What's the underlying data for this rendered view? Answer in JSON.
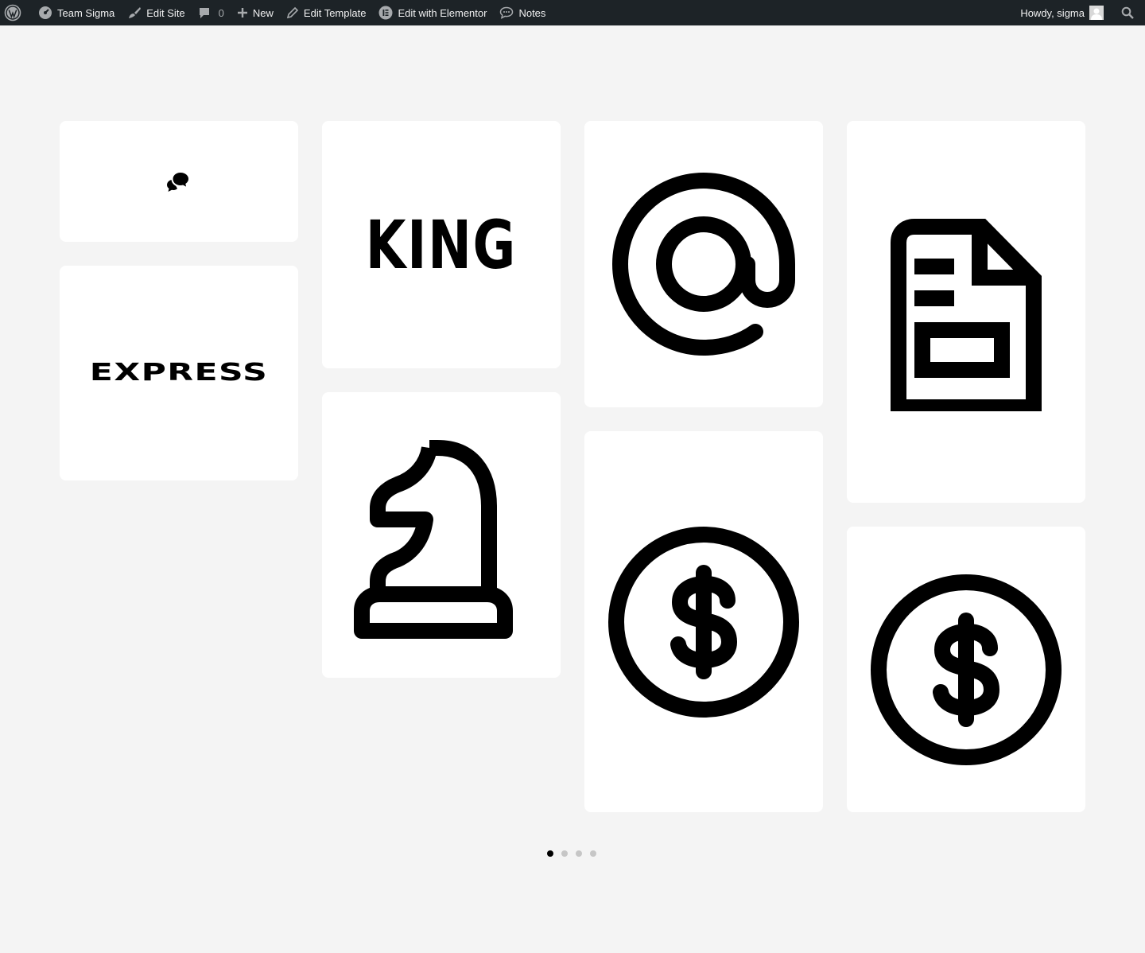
{
  "adminbar": {
    "site_name": "Team Sigma",
    "edit_site": "Edit Site",
    "comments_count": "0",
    "new_label": "New",
    "edit_template": "Edit Template",
    "edit_elementor": "Edit with Elementor",
    "notes": "Notes",
    "howdy": "Howdy, sigma"
  },
  "cards": {
    "king_logo": "KING",
    "express_logo": "EXPRESS",
    "icons": [
      "chat-bubbles-icon",
      "at-sign-icon",
      "document-icon",
      "chess-knight-icon",
      "dollar-coin-icon",
      "dollar-coin-icon"
    ]
  },
  "pagination": {
    "total": 4,
    "active": 1
  },
  "colors": {
    "adminbar_bg": "#1d2327",
    "page_bg": "#f4f4f4",
    "card_bg": "#ffffff",
    "icon": "#000000"
  }
}
